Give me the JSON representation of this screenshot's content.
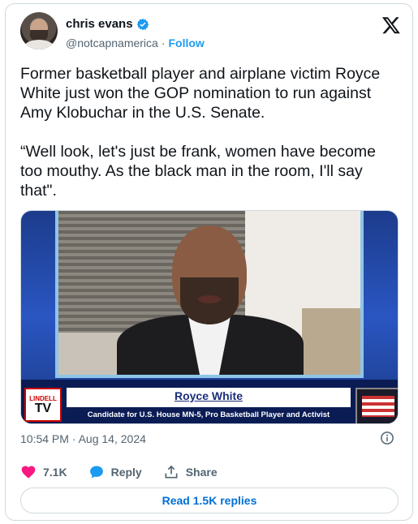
{
  "author": {
    "display_name": "chris evans",
    "handle": "@notcapnamerica",
    "separator": "·",
    "follow_label": "Follow"
  },
  "tweet": {
    "text": "Former basketball player and airplane victim Royce White just won the GOP nomination to run against Amy Klobuchar in the U.S. Senate.\n\n“Well look, let's just be frank, women have become too mouthy. As the black man in the room, I'll say that\"."
  },
  "media": {
    "logo_top": "LINDELL",
    "logo_bottom": "TV",
    "lower_third_name": "Royce White",
    "lower_third_caption": "Candidate for U.S. House MN-5, Pro Basketball Player and Activist"
  },
  "timestamp": "10:54 PM · Aug 14, 2024",
  "actions": {
    "like_count": "7.1K",
    "reply_label": "Reply",
    "share_label": "Share"
  },
  "read_replies_label": "Read 1.5K replies",
  "colors": {
    "accent": "#1d9bf0",
    "like": "#f91880",
    "text_secondary": "#536471"
  },
  "icons": [
    "verified-badge-icon",
    "x-logo-icon",
    "info-icon",
    "heart-icon",
    "reply-bubble-icon",
    "share-icon"
  ]
}
